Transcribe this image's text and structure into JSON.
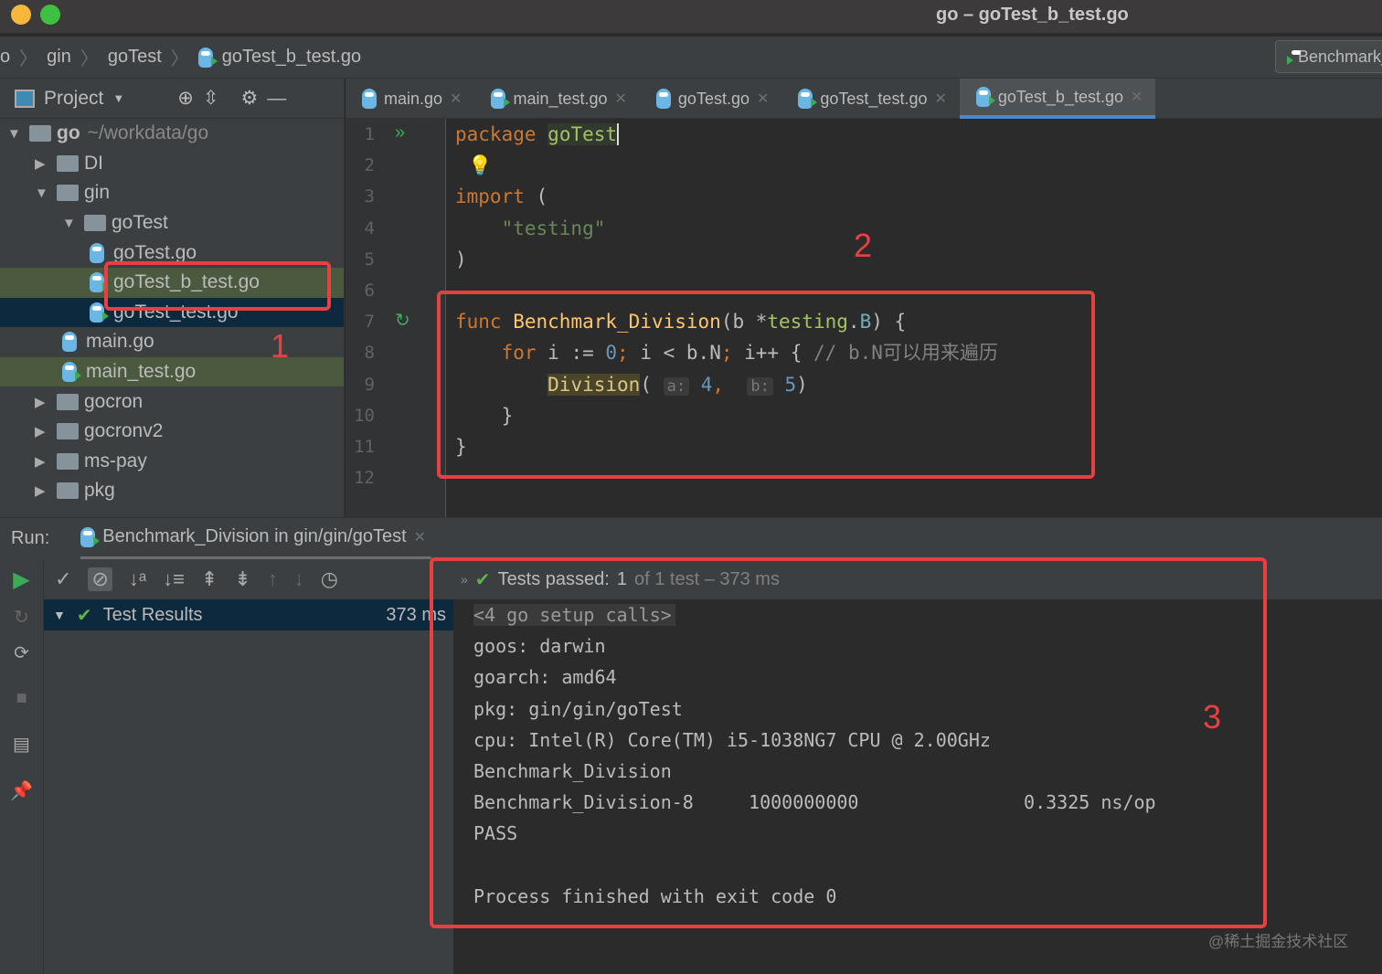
{
  "window": {
    "title": "go – goTest_b_test.go"
  },
  "breadcrumb": [
    "o",
    "gin",
    "goTest",
    "goTest_b_test.go"
  ],
  "run_config": "Benchmark_Division",
  "project_panel": {
    "title": "Project",
    "tree": [
      {
        "label": "go",
        "suffix": "~/workdata/go",
        "depth": 0,
        "type": "folder",
        "expanded": true
      },
      {
        "label": "DI",
        "depth": 1,
        "type": "folder",
        "expanded": false
      },
      {
        "label": "gin",
        "depth": 1,
        "type": "folder",
        "expanded": true
      },
      {
        "label": "goTest",
        "depth": 2,
        "type": "folder",
        "expanded": true
      },
      {
        "label": "goTest.go",
        "depth": 3,
        "type": "file"
      },
      {
        "label": "goTest_b_test.go",
        "depth": 3,
        "type": "testfile",
        "selected": true
      },
      {
        "label": "goTest_test.go",
        "depth": 3,
        "type": "testfile"
      },
      {
        "label": "main.go",
        "depth": 2,
        "type": "file"
      },
      {
        "label": "main_test.go",
        "depth": 2,
        "type": "testfile"
      },
      {
        "label": "gocron",
        "depth": 1,
        "type": "folder",
        "expanded": false
      },
      {
        "label": "gocronv2",
        "depth": 1,
        "type": "folder",
        "expanded": false
      },
      {
        "label": "ms-pay",
        "depth": 1,
        "type": "folder",
        "expanded": false
      },
      {
        "label": "pkg",
        "depth": 1,
        "type": "folder",
        "expanded": false
      }
    ]
  },
  "tabs": [
    {
      "label": "main.go",
      "test": false
    },
    {
      "label": "main_test.go",
      "test": true
    },
    {
      "label": "goTest.go",
      "test": false
    },
    {
      "label": "goTest_test.go",
      "test": true
    },
    {
      "label": "goTest_b_test.go",
      "test": true,
      "active": true
    }
  ],
  "editor": {
    "line_numbers": [
      "1",
      "2",
      "3",
      "4",
      "5",
      "6",
      "7",
      "8",
      "9",
      "10",
      "11",
      "12"
    ],
    "code": {
      "l1_kw": "package",
      "l1_pkg": "goTest",
      "l3_kw": "import",
      "l3_p": " (",
      "l4": "    \"testing\"",
      "l5": ")",
      "l7_kw": "func",
      "l7_fn": "Benchmark_Division",
      "l7_a": "(b *",
      "l7_t": "testing",
      "l7_b": ".",
      "l7_B": "B",
      "l7_c": ") {",
      "l8_kw": "for",
      "l8_a": " i := ",
      "l8_0": "0",
      "l8_s": ";",
      "l8_b": " i < b.N",
      "l8_s2": ";",
      "l8_c": " i++ { ",
      "l8_cm": "// b.N可以用来遍历",
      "l9_fn": "Division",
      "l9_p": "(",
      "l9_ha": "a:",
      "l9_4": "4",
      "l9_c": ",",
      "l9_hb": "b:",
      "l9_5": "5",
      "l9_e": ")",
      "l10": "    }",
      "l11": "}"
    }
  },
  "run": {
    "label": "Run:",
    "tab": "Benchmark_Division in gin/gin/goTest",
    "status_pass": "Tests passed:",
    "status_count": "1",
    "status_rest": "of 1 test – 373 ms",
    "tree_root": "Test Results",
    "tree_time": "373 ms",
    "console": [
      "<4 go setup calls>",
      "goos: darwin",
      "goarch: amd64",
      "pkg: gin/gin/goTest",
      "cpu: Intel(R) Core(TM) i5-1038NG7 CPU @ 2.00GHz",
      "Benchmark_Division",
      "Benchmark_Division-8     1000000000               0.3325 ns/op",
      "PASS",
      "",
      "Process finished with exit code 0"
    ]
  },
  "annotations": [
    "1",
    "2",
    "3"
  ],
  "watermark": "@稀土掘金技术社区",
  "colors": {
    "annotation": "#e84040",
    "accent": "#4a88c7",
    "pass": "#5fb14f"
  }
}
